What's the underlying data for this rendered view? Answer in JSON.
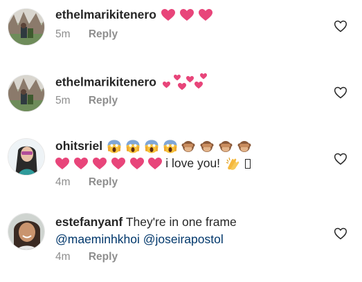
{
  "comments": [
    {
      "username": "ethelmarikitenero",
      "text": "",
      "text_line2": "",
      "time": "5m",
      "reply": "Reply",
      "emojis": [
        "heart-pink",
        "heart-pink",
        "heart-pink"
      ]
    },
    {
      "username": "ethelmarikitenero",
      "text": "",
      "text_line2": "",
      "time": "5m",
      "reply": "Reply",
      "emojis": [
        "floating-hearts"
      ]
    },
    {
      "username": "ohitsriel",
      "text": "",
      "text_line2": "i love you!",
      "time": "4m",
      "reply": "Reply",
      "emojis": [
        "screaming-face",
        "screaming-face",
        "screaming-face",
        "screaming-face",
        "see-no-evil-monkey",
        "see-no-evil-monkey",
        "see-no-evil-monkey",
        "see-no-evil-monkey"
      ],
      "emojis_line2": [
        "heart-pink",
        "heart-pink",
        "heart-pink",
        "heart-pink",
        "heart-pink",
        "heart-pink"
      ],
      "emojis_after_text": [
        "clapping-hands",
        "missing-glyph"
      ]
    },
    {
      "username": "estefanyanf",
      "text": "They're in one frame",
      "mention1": "@maeminhkhoi",
      "mention2": "@joseirapostol",
      "time": "4m",
      "reply": "Reply"
    }
  ],
  "colors": {
    "text": "#262626",
    "meta": "#8e8e8e",
    "mention": "#00376b",
    "heart": "#e8457a"
  },
  "icons": [
    "like-heart-outline-icon"
  ]
}
